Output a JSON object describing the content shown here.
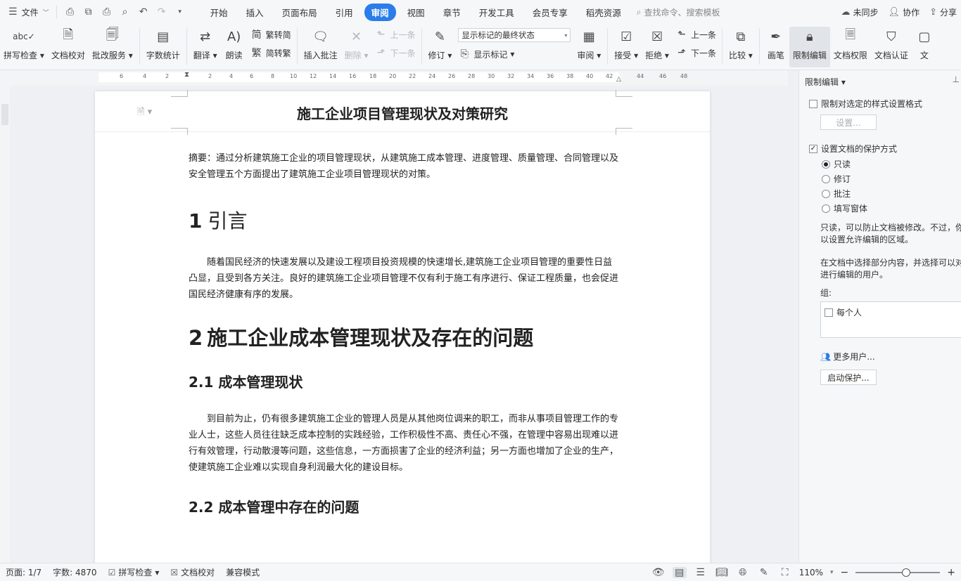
{
  "menubar": {
    "file_label": "文件",
    "tabs": [
      {
        "label": "开始"
      },
      {
        "label": "插入"
      },
      {
        "label": "页面布局"
      },
      {
        "label": "引用"
      },
      {
        "label": "审阅",
        "active": true
      },
      {
        "label": "视图"
      },
      {
        "label": "章节"
      },
      {
        "label": "开发工具"
      },
      {
        "label": "会员专享"
      },
      {
        "label": "稻壳资源"
      }
    ],
    "search_placeholder": "查找命令、搜索模板",
    "right": {
      "sync": "未同步",
      "collab": "协作",
      "share": "分享"
    }
  },
  "ribbon": {
    "spell_check": "拼写检查",
    "doc_proof": "文档校对",
    "correction_service": "批改服务",
    "word_count": "字数统计",
    "translate": "翻译",
    "read_aloud": "朗读",
    "trad_to_simp": "繁转简",
    "simp_to_trad": "简转繁",
    "insert_comment": "插入批注",
    "delete": "删除",
    "prev_comment": "上一条",
    "next_comment": "下一条",
    "revise": "修订",
    "markup_state": "显示标记的最终状态",
    "show_markup": "显示标记",
    "review": "审阅",
    "accept": "接受",
    "reject": "拒绝",
    "prev_change": "上一条",
    "next_change": "下一条",
    "compare": "比较",
    "pen": "画笔",
    "restrict_edit": "限制编辑",
    "doc_permission": "文档权限",
    "doc_auth": "文档认证",
    "overflow": "文"
  },
  "ruler": {
    "ticks": [
      "6",
      "4",
      "2",
      "2",
      "4",
      "6",
      "8",
      "10",
      "12",
      "14",
      "16",
      "18",
      "20",
      "22",
      "24",
      "26",
      "28",
      "30",
      "32",
      "34",
      "36",
      "38",
      "40",
      "42",
      "44",
      "46",
      "48"
    ]
  },
  "document": {
    "title": "施工企业项目管理现状及对策研究",
    "abstract": "摘要：通过分析建筑施工企业的项目管理现状，从建筑施工成本管理、进度管理、质量管理、合同管理以及安全管理五个方面提出了建筑施工企业项目管理现状的对策。",
    "h1_num": "1",
    "h1_text": "引言",
    "para1": "随着国民经济的快速发展以及建设工程项目投资规模的快速增长,建筑施工企业项目管理的重要性日益凸显，且受到各方关注。良好的建筑施工企业项目管理不仅有利于施工有序进行、保证工程质量，也会促进国民经济健康有序的发展。",
    "h2_num": "2",
    "h2_text": "施工企业成本管理现状及存在的问题",
    "h21": "2.1 成本管理现状",
    "para2": "到目前为止，仍有很多建筑施工企业的管理人员是从其他岗位调来的职工，而非从事项目管理工作的专业人士，这些人员往往缺乏成本控制的实践经验，工作积极性不高、责任心不强，在管理中容易出现难以进行有效管理，行动散漫等问题，这些信息，一方面损害了企业的经济利益；另一方面也增加了企业的生产，使建筑施工企业难以实现自身利润最大化的建设目标。",
    "h22": "2.2 成本管理中存在的问题"
  },
  "pane": {
    "title": "限制编辑",
    "limit_format": "限制对选定的样式设置格式",
    "settings_btn": "设置...",
    "protect_method": "设置文档的保护方式",
    "options": [
      {
        "label": "只读",
        "selected": true
      },
      {
        "label": "修订",
        "selected": false
      },
      {
        "label": "批注",
        "selected": false
      },
      {
        "label": "填写窗体",
        "selected": false
      }
    ],
    "desc1_line1": "只读，可以防止文档被修改。不过，你",
    "desc1_line2": "以设置允许编辑的区域。",
    "desc2_line1": "在文档中选择部分内容，并选择可以对",
    "desc2_line2": "进行编辑的用户。",
    "group_label": "组:",
    "everyone": "每个人",
    "more_users": "更多用户...",
    "start_protect": "启动保护..."
  },
  "status": {
    "page": "页面: 1/7",
    "words": "字数: 4870",
    "spell": "拼写检查",
    "proof": "文档校对",
    "compat": "兼容模式",
    "zoom": "110%",
    "zoom_fraction": 0.6
  }
}
